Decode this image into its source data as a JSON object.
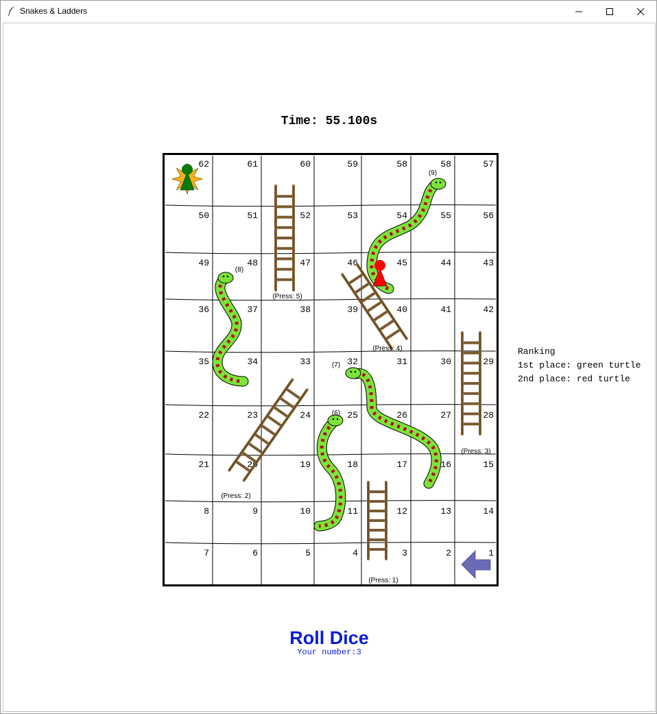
{
  "window": {
    "title": "Snakes & Ladders"
  },
  "game": {
    "timer_text": "Time: 55.100s",
    "roll_button_label": "Roll Dice",
    "your_number_text": "Your number:3",
    "ranking": {
      "heading": "Ranking",
      "first": "1st place: green turtle",
      "second": "2nd place: red turtle"
    },
    "board": {
      "rows": [
        [
          "62",
          "61",
          "60",
          "59",
          "58",
          "58",
          "57"
        ],
        [
          "50",
          "51",
          "52",
          "53",
          "54",
          "55",
          "56"
        ],
        [
          "49",
          "48",
          "47",
          "46",
          "45",
          "44",
          "43"
        ],
        [
          "36",
          "37",
          "38",
          "39",
          "40",
          "41",
          "42"
        ],
        [
          "35",
          "34",
          "33",
          "32",
          "31",
          "30",
          "29"
        ],
        [
          "22",
          "23",
          "24",
          "25",
          "26",
          "27",
          "28"
        ],
        [
          "21",
          "20",
          "19",
          "18",
          "17",
          "16",
          "15"
        ],
        [
          "8",
          "9",
          "10",
          "11",
          "12",
          "13",
          "14"
        ],
        [
          "7",
          "6",
          "5",
          "4",
          "3",
          "2",
          "1"
        ]
      ],
      "ladder_labels": [
        "(Press: 1)",
        "(Press: 2)",
        "(Press: 3)",
        "(Press: 4)",
        "(Press: 5)"
      ],
      "snake_labels": [
        "(6)",
        "(7)",
        "(8)",
        "(9)"
      ],
      "players": [
        {
          "name": "green turtle",
          "color": "#0a7a0a",
          "square": "62"
        },
        {
          "name": "red turtle",
          "color": "#ff0000",
          "square": "45"
        }
      ],
      "start_arrow_color": "#6b6bb5"
    }
  }
}
